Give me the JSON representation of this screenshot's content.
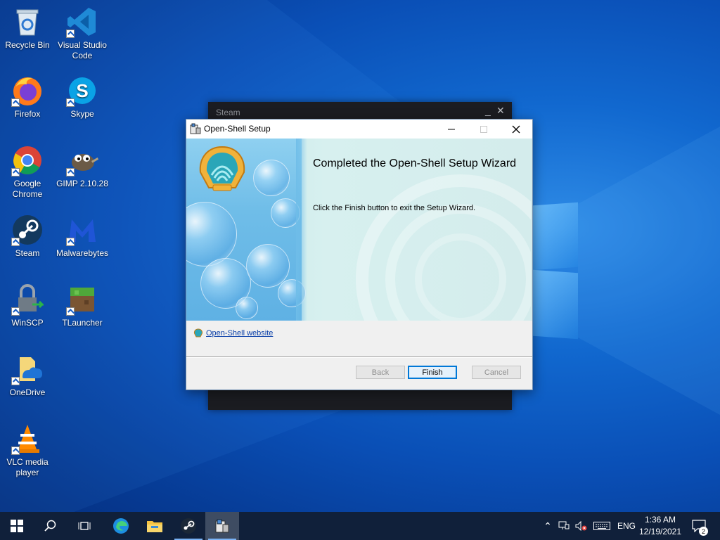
{
  "desktop": {
    "icons": [
      {
        "label": "Recycle Bin"
      },
      {
        "label": "Visual Studio Code"
      },
      {
        "label": "Firefox"
      },
      {
        "label": "Skype"
      },
      {
        "label": "Google Chrome"
      },
      {
        "label": "GIMP 2.10.28"
      },
      {
        "label": "Steam"
      },
      {
        "label": "Malwarebytes"
      },
      {
        "label": "WinSCP"
      },
      {
        "label": "TLauncher"
      },
      {
        "label": "OneDrive"
      },
      {
        "label": "VLC media player"
      }
    ]
  },
  "steam_window": {
    "title": "Steam"
  },
  "setup_dialog": {
    "title": "Open-Shell Setup",
    "heading": "Completed the Open-Shell Setup Wizard",
    "description": "Click the Finish button to exit the Setup Wizard.",
    "website_link": "Open-Shell website",
    "buttons": {
      "back": "Back",
      "finish": "Finish",
      "cancel": "Cancel"
    }
  },
  "taskbar": {
    "language": "ENG",
    "time": "1:36 AM",
    "date": "12/19/2021",
    "notification_count": "2"
  },
  "colors": {
    "accent": "#0078d7",
    "taskbar": "#10203a",
    "link": "#0a3fa8"
  }
}
